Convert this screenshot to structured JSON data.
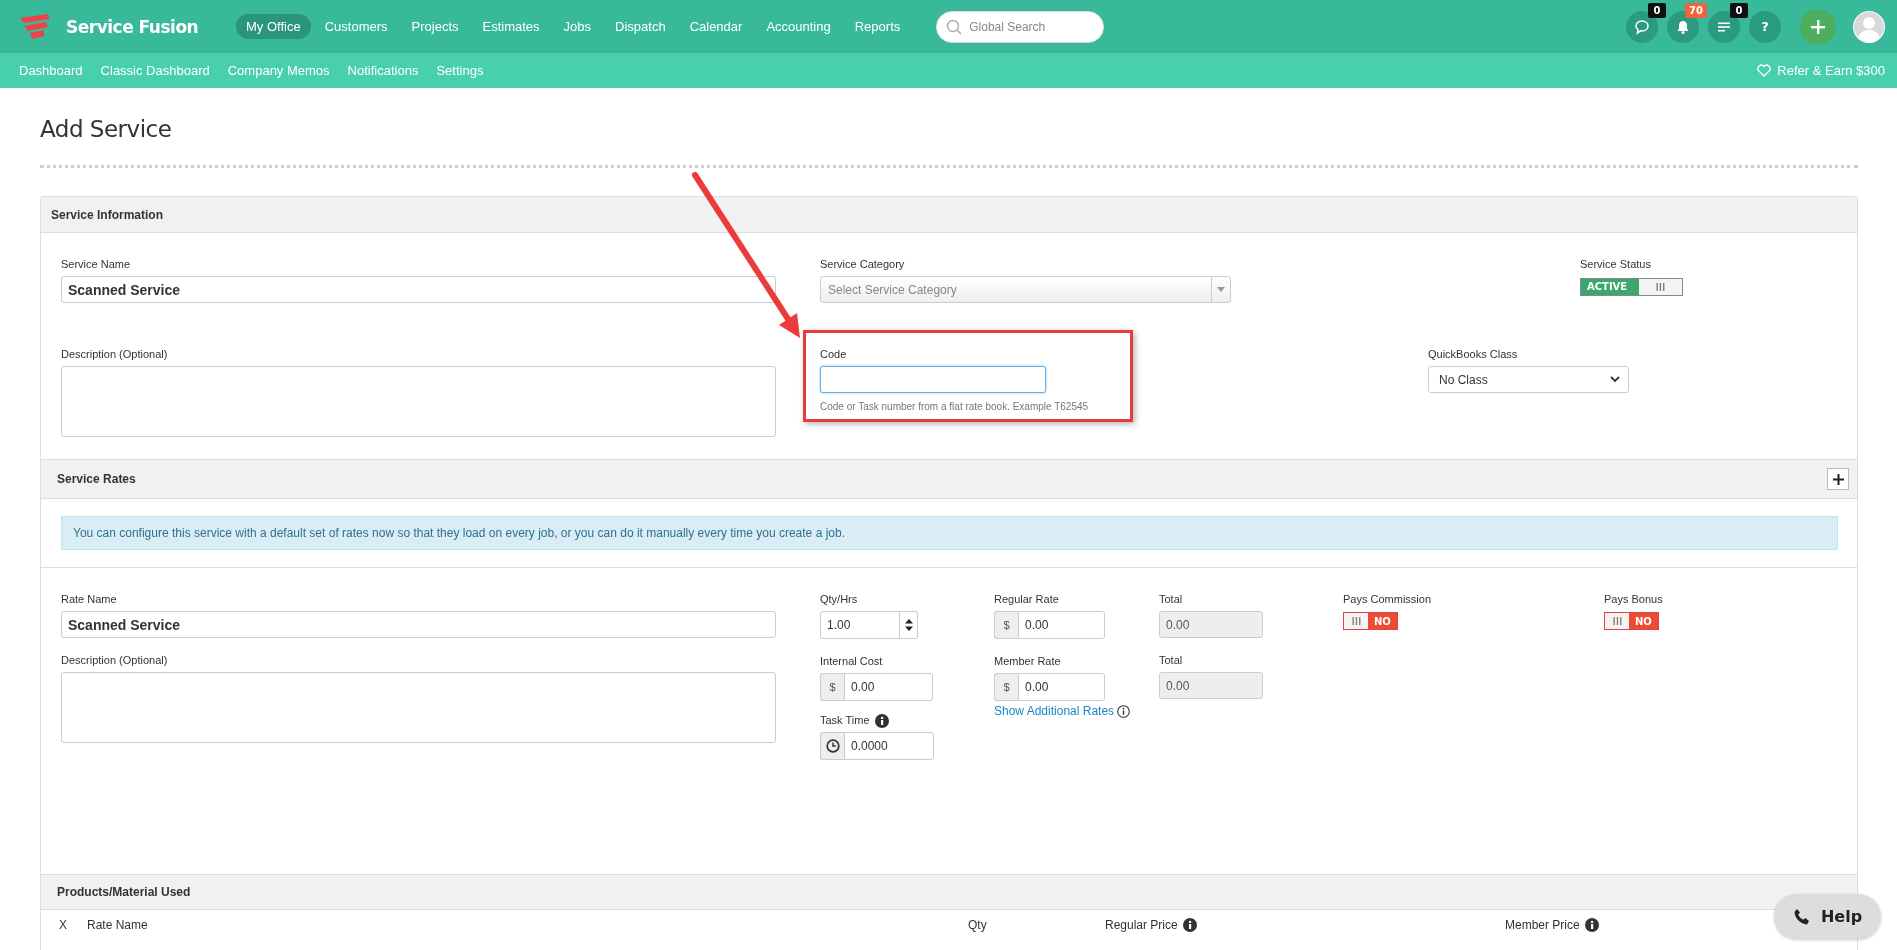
{
  "brand": {
    "name": "Service Fusion"
  },
  "main_nav": [
    {
      "label": "My Office",
      "selected": true
    },
    {
      "label": "Customers",
      "selected": false
    },
    {
      "label": "Projects",
      "selected": false
    },
    {
      "label": "Estimates",
      "selected": false
    },
    {
      "label": "Jobs",
      "selected": false
    },
    {
      "label": "Dispatch",
      "selected": false
    },
    {
      "label": "Calendar",
      "selected": false
    },
    {
      "label": "Accounting",
      "selected": false
    },
    {
      "label": "Reports",
      "selected": false
    }
  ],
  "search": {
    "placeholder": "Global Search"
  },
  "header_buttons": [
    {
      "kind": "chat",
      "badge": "0",
      "color": "#111111"
    },
    {
      "kind": "bell",
      "badge": "70",
      "color": "#f0643c"
    },
    {
      "kind": "list",
      "badge": "0",
      "color": "#111111"
    },
    {
      "kind": "help",
      "label": "?"
    },
    {
      "kind": "add"
    },
    {
      "kind": "avatar"
    }
  ],
  "sub_nav": [
    "Dashboard",
    "Classic Dashboard",
    "Company Memos",
    "Notifications",
    "Settings"
  ],
  "refer_link": "Refer & Earn $300",
  "page_title": "Add Service",
  "service_information": {
    "title": "Service Information",
    "service_name": {
      "label": "Service Name",
      "value": "Scanned Service"
    },
    "service_category": {
      "label": "Service Category",
      "placeholder": "Select Service Category"
    },
    "service_status": {
      "label": "Service Status",
      "on": true,
      "text": "ACTIVE"
    },
    "description": {
      "label": "Description (Optional)"
    },
    "code": {
      "label": "Code",
      "focused": true,
      "highlighted": true,
      "help": "Code or Task number from a flat rate book. Example T62545"
    },
    "quickbooks_class": {
      "label": "QuickBooks Class",
      "value": "No Class"
    }
  },
  "service_rates": {
    "title": "Service Rates",
    "notice": "You can configure this service with a default set of rates now so that they load on every job, or you can do it manually every time you create a job.",
    "rate_name": {
      "label": "Rate Name",
      "value": "Scanned Service"
    },
    "description": {
      "label": "Description (Optional)"
    },
    "qty_hrs": {
      "label": "Qty/Hrs",
      "value": "1.00"
    },
    "internal_cost": {
      "label": "Internal Cost",
      "prefix": "$",
      "value": "0.00"
    },
    "task_time": {
      "label": "Task Time",
      "value": "0.0000"
    },
    "regular_rate": {
      "label": "Regular Rate",
      "prefix": "$",
      "value": "0.00"
    },
    "member_rate": {
      "label": "Member Rate",
      "prefix": "$",
      "value": "0.00"
    },
    "regular_total": {
      "label": "Total",
      "value": "0.00"
    },
    "member_total": {
      "label": "Total",
      "value": "0.00"
    },
    "show_additional_rates": "Show Additional Rates",
    "pays_commission": {
      "label": "Pays Commission",
      "on": false,
      "text": "NO"
    },
    "pays_bonus": {
      "label": "Pays Bonus",
      "on": false,
      "text": "NO"
    }
  },
  "products_material": {
    "title": "Products/Material Used",
    "columns": [
      {
        "label": "X",
        "kind": "plain"
      },
      {
        "label": "Rate Name",
        "kind": "plain"
      },
      {
        "label": "Qty",
        "kind": "plain"
      },
      {
        "label": "Regular Price",
        "kind": "info"
      },
      {
        "label": "Member Price",
        "kind": "info"
      }
    ]
  },
  "help_button": "Help"
}
